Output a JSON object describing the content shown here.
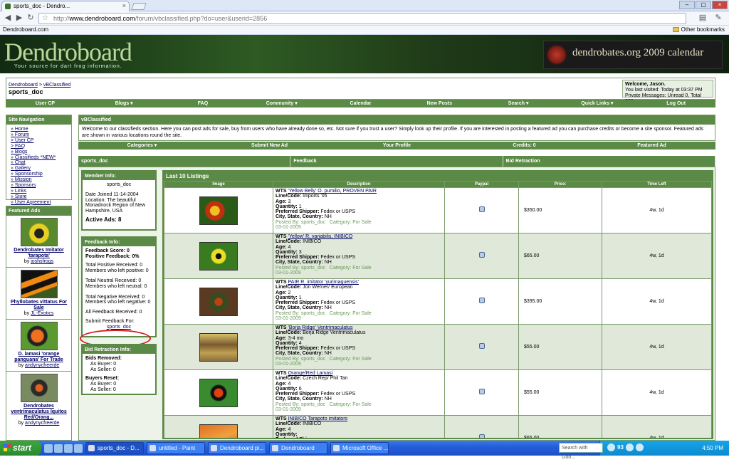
{
  "browser": {
    "tab_title": "sports_doc - Dendro...",
    "url_host": "www.dendroboard.com",
    "url_prefix": "http://",
    "url_path": "/forum/vbclassified.php?do=user&userid=2856",
    "bookmark": "Dendroboard.com",
    "other_bookmarks": "Other bookmarks"
  },
  "banner": {
    "logo": "Dendroboard",
    "tagline": "Your source for dart frog information.",
    "ad": "dendrobates.org 2009 calendar"
  },
  "breadcrumb": {
    "root": "Dendroboard",
    "sep": ">",
    "section": "vBClassified",
    "title": "sports_doc"
  },
  "welcome": {
    "line1": "Welcome, Jason.",
    "line2": "You last visited: Today at 03:37 PM",
    "line3": "Private Messages: Unread 0, Total 339."
  },
  "main_nav": [
    "User CP",
    "Blogs ▾",
    "FAQ",
    "Community ▾",
    "Calendar",
    "New Posts",
    "Search ▾",
    "Quick Links ▾",
    "Log Out"
  ],
  "site_nav": {
    "title": "Site Navigation",
    "items": [
      "» Home",
      "» Forum",
      "  > User CP",
      "  > FAQ",
      "» Blogs",
      "» Classifieds *NEW*",
      "» Chat",
      "» Gallery",
      "» Sponsorship",
      "» Mission",
      "» Sponsors",
      "» Links",
      "» Store",
      "» User Agreement"
    ]
  },
  "featured": {
    "title": "Featured Ads",
    "ads": [
      {
        "title": "Dendrobates Imitator 'tarapota'",
        "by": "by",
        "user": "joshsfrogs"
      },
      {
        "title": "Phyllobates vittatus For Sale",
        "by": "by",
        "user": "JL-Exotics"
      },
      {
        "title": "D. lamasi 'orange panguana' For Trade",
        "by": "by",
        "user": "andynycfreerde"
      },
      {
        "title": "Dendrobates ventrimaculatus Iquitos Red/Orang...",
        "by": "by",
        "user": "andynycfreerde"
      }
    ]
  },
  "vbc": {
    "title": "vBClassified",
    "intro": "Welcome to our classifieds section. Here you can post ads for sale, buy from users who have already done so, etc. Not sure if you trust a user? Simply look up their profile. If you are interested in posting a featured ad you can purchase credits or become a site sponsor. Featured ads are shown in various locations round the site.",
    "bar": [
      "Categories ▾",
      "Submit New Ad",
      "Your Profile",
      "Credits: 0",
      "Featured Ad"
    ]
  },
  "profile_tabs": [
    "sports_doc",
    "Feedback",
    "Bid Retraction"
  ],
  "member": {
    "title": "Member Info:",
    "name": "sports_doc",
    "joined": "Date Joined 11-14-2004",
    "location": "Location: The beautiful Monadnock Region of New Hampshire, USA",
    "active": "Active Ads: 8"
  },
  "feedback": {
    "title": "Feedback Info:",
    "score": "Feedback Score: 0",
    "positive": "Positive Feedback: 0%",
    "tpr": "Total Positive Received: 0",
    "tpl": "Members who left positive: 0",
    "tnr": "Total Neutral Received: 0",
    "tnl": "Members who left neutral: 0",
    "tngr": "Total Negative Received: 0",
    "tngl": "Members who left negative: 0",
    "all": "All Feedback Received: 0",
    "submit": "Submit Feedback For:",
    "submit_user": "sports_doc"
  },
  "bid": {
    "title": "Bid Retraction Info:",
    "removed": "Bids Removed:",
    "rb": "As Buyer: 0",
    "rs": "As Seller: 0",
    "reset": "Buyers Reset:",
    "sb": "As Buyer: 0",
    "ss": "As Seller: 0"
  },
  "listings": {
    "title": "Last 10 Listings",
    "headers": [
      "Image",
      "Description",
      "Paypal",
      "Price:",
      "Time Left"
    ],
    "rows": [
      {
        "wts": "WTS",
        "title": "'Yellow Belly' O. pumilio, PROVEN PAIR",
        "line": "Imports '05",
        "age": "3",
        "qty": "1",
        "ship": "Fedex or USPS",
        "csc": "NH",
        "by": "sports_doc",
        "cat": "For Sale",
        "date": "03-01-2009",
        "price": "$350.00",
        "time": "4w, 1d"
      },
      {
        "wts": "WTS",
        "title": "'Yellow' R. variabilis, INIBICO",
        "line": "INIBICO",
        "age": "4",
        "qty": "3",
        "ship": "Fedex or USPS",
        "csc": "NH",
        "by": "sports_doc",
        "cat": "For Sale",
        "date": "03-01-2009",
        "price": "$65.00",
        "time": "4w, 1d"
      },
      {
        "wts": "WTS",
        "title": "PAIR R. imitator 'yurimaguensis'",
        "line": "Jon Werner/ European",
        "age": "2",
        "qty": "1",
        "ship": "Fedex or USPS",
        "csc": "NH",
        "by": "sports_doc",
        "cat": "For Sale",
        "date": "03-01-2009",
        "price": "$395.00",
        "time": "4w, 1d"
      },
      {
        "wts": "WTS",
        "title": "'Borja Ridge' Ventrimaculatus",
        "line": "Borja Ridge Ventrimaculatus",
        "age": "3-4 mo",
        "qty": "4",
        "ship": "Fedex or USPS",
        "csc": "NH",
        "by": "sports_doc",
        "cat": "For Sale",
        "date": "03-01-2009",
        "price": "$55.00",
        "time": "4w, 1d"
      },
      {
        "wts": "WTS",
        "title": "Orange/Red Lamasi",
        "line": "Czech Rep/ Phil Tan",
        "age": "4",
        "qty": "6",
        "ship": "Fedex or USPS",
        "csc": "NH",
        "by": "sports_doc",
        "cat": "For Sale",
        "date": "03-01-2009",
        "price": "$55.00",
        "time": "4w, 1d"
      },
      {
        "wts": "WTS",
        "title": "INIBICO Tarapoto imitators",
        "line": "INIBICO",
        "age": "4",
        "qty": "",
        "ship": "",
        "csc": "",
        "by": "",
        "cat": "",
        "date": "",
        "price": "$65.00",
        "time": "4w, 1d"
      }
    ],
    "labels": {
      "line": "Line/Code:",
      "age": "Age:",
      "qty": "Quantity:",
      "ship": "Preferred Shipper:",
      "csc": "City, State, Country:",
      "by": "Posted By:",
      "cat": "Category:"
    }
  },
  "taskbar": {
    "start": "start",
    "tasks": [
      "sports_doc - D...",
      "untitled - Paint",
      "Dendroboard pi...",
      "Dendroboard",
      "Microsoft Office ..."
    ],
    "search": "Search with Goo...",
    "clock": "4:50 PM",
    "battery": "93"
  }
}
